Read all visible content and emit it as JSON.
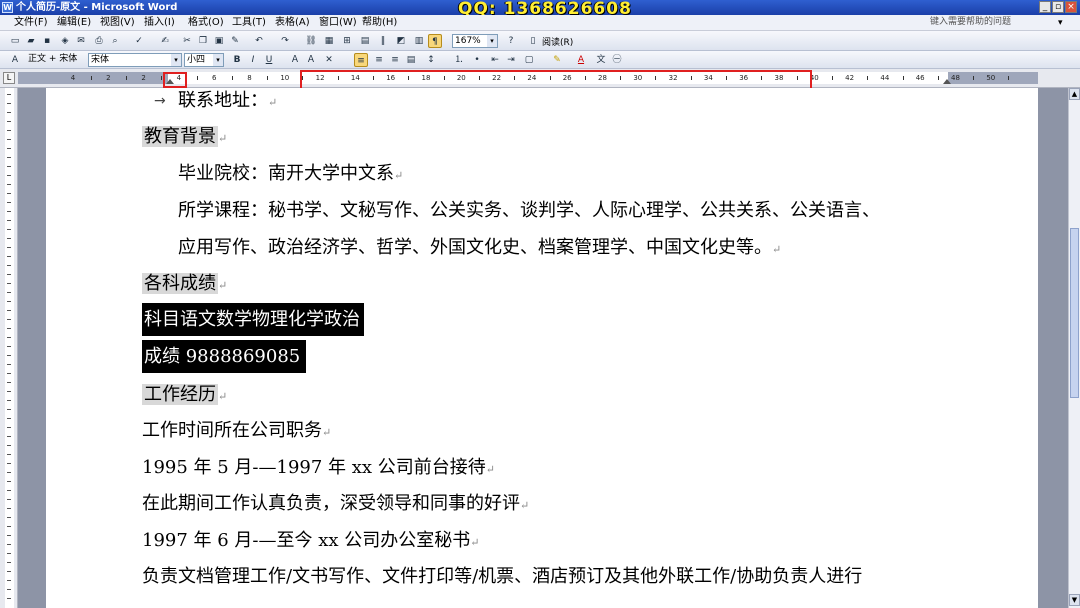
{
  "window": {
    "title": "个人简历-原文 - Microsoft Word",
    "overlay_text": "QQ: 1368626608",
    "buttons": {
      "minimize": "_",
      "restore": "▫",
      "close": "×"
    }
  },
  "menu": {
    "items": [
      "文件(F)",
      "编辑(E)",
      "视图(V)",
      "插入(I)",
      "格式(O)",
      "工具(T)",
      "表格(A)",
      "窗口(W)",
      "帮助(H)"
    ],
    "help_placeholder": "键入需要帮助的问题"
  },
  "toolbar": {
    "zoom": "167%",
    "reading_label": "阅读(R)",
    "style": "正文 + 宋体",
    "font": "宋体",
    "font_size": "小四",
    "bold": "B",
    "italic": "I",
    "underline": "U"
  },
  "ruler": {
    "corner": "L",
    "numbers": [
      "4",
      "2",
      "2",
      "4",
      "6",
      "8",
      "10",
      "12",
      "14",
      "16",
      "18",
      "20",
      "22",
      "24",
      "26",
      "28",
      "30",
      "32",
      "34",
      "36",
      "38",
      "40",
      "42",
      "44",
      "46",
      "48",
      "50"
    ]
  },
  "document": {
    "address_label": "联系地址：",
    "education_heading": "教育背景",
    "school": "毕业院校：南开大学中文系",
    "courses_line1": "所学课程：秘书学、文秘写作、公关实务、谈判学、人际心理学、公共关系、公关语言、",
    "courses_line2": "应用写作、政治经济学、哲学、外国文化史、档案管理学、中国文化史等。",
    "grades_heading": "各科成绩",
    "grades_subjects": "科目语文数学物理化学政治",
    "grades_scores": "成绩 9888869085",
    "work_heading": "工作经历",
    "work_columns": "工作时间所在公司职务",
    "job1": "1995 年 5 月-—1997 年 xx 公司前台接待",
    "job1_desc": "在此期间工作认真负责，深受领导和同事的好评",
    "job2": "1997 年 6 月-—至今 xx 公司办公室秘书",
    "job2_desc": "负责文档管理工作/文书写作、文件打印等/机票、酒店预订及其他外联工作/协助负责人进行"
  },
  "colors": {
    "title_bar": "#2f5fd0",
    "highlight_box": "#e02020",
    "selection": "#000000",
    "heading_shading": "#d8d8d8"
  }
}
